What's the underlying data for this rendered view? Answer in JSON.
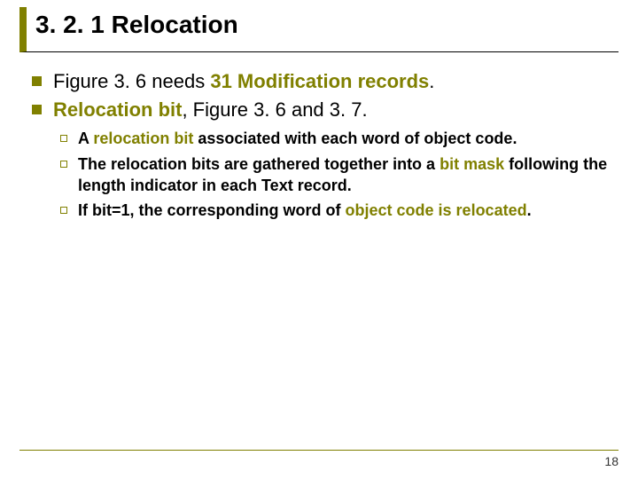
{
  "slide": {
    "title": "3. 2. 1  Relocation",
    "bullets": [
      {
        "pre": "Figure 3. 6 needs ",
        "em": "31 Modification records",
        "post": "."
      },
      {
        "em": "Relocation bit",
        "post": ", Figure 3. 6 and 3. 7."
      }
    ],
    "subbullets": [
      {
        "pre": "A ",
        "em": "relocation bit",
        "post": " associated with each word of object code."
      },
      {
        "pre": "The relocation bits are gathered together into a ",
        "em": "bit mask",
        "post": " following the length indicator in each Text record."
      },
      {
        "pre": "If bit=1, the corresponding word of ",
        "em": "object code is relocated",
        "post": "."
      }
    ],
    "page_number": "18"
  }
}
